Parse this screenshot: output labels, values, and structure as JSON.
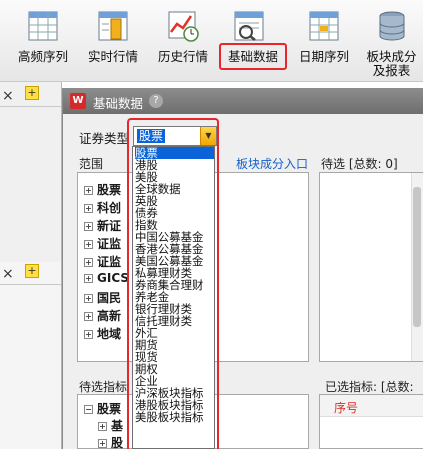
{
  "toolbar": {
    "items": [
      {
        "label": "高频序列",
        "icon": "spreadsheet-icon"
      },
      {
        "label": "实时行情",
        "icon": "realtime-quote-icon"
      },
      {
        "label": "历史行情",
        "icon": "history-chart-icon"
      },
      {
        "label": "基础数据",
        "icon": "basic-data-icon"
      },
      {
        "label": "日期序列",
        "icon": "date-series-icon"
      },
      {
        "label": "板块成分及报表",
        "line1": "板块成分",
        "line2": "及报表",
        "icon": "database-icon"
      }
    ],
    "highlight_color": "#e8262b"
  },
  "left_panel": {
    "close": "×",
    "add": "+"
  },
  "dialog": {
    "title": "基础数据",
    "help": "?",
    "security_type_label": "证券类型",
    "security_type_value": "股票",
    "range_label": "范围",
    "block_link": "板块成分入口",
    "pending_label": "待选 [总数: 0]",
    "indicator_label": "待选指标",
    "selected_label": "已选指标: [总数:",
    "seq_header": "序号",
    "range_tree": [
      "股票",
      "科创",
      "新证",
      "证监",
      "证监",
      "GICS",
      "国民",
      "高新",
      "地域"
    ],
    "indicator_tree": [
      "股票",
      "基",
      "股"
    ]
  },
  "dropdown": {
    "selected": "股票",
    "options": [
      "股票",
      "港股",
      "美股",
      "全球数据",
      "英股",
      "债券",
      "指数",
      "中国公募基金",
      "香港公募基金",
      "美国公募基金",
      "私募理财类",
      "券商集合理财",
      "养老金",
      "银行理财类",
      "信托理财类",
      "外汇",
      "期货",
      "现货",
      "期权",
      "企业",
      "沪深板块指标",
      "港股板块指标",
      "美股板块指标"
    ]
  },
  "colors": {
    "accent": "#0a63d8",
    "link": "#1560c8",
    "titlebar": "#7a7a7a"
  }
}
